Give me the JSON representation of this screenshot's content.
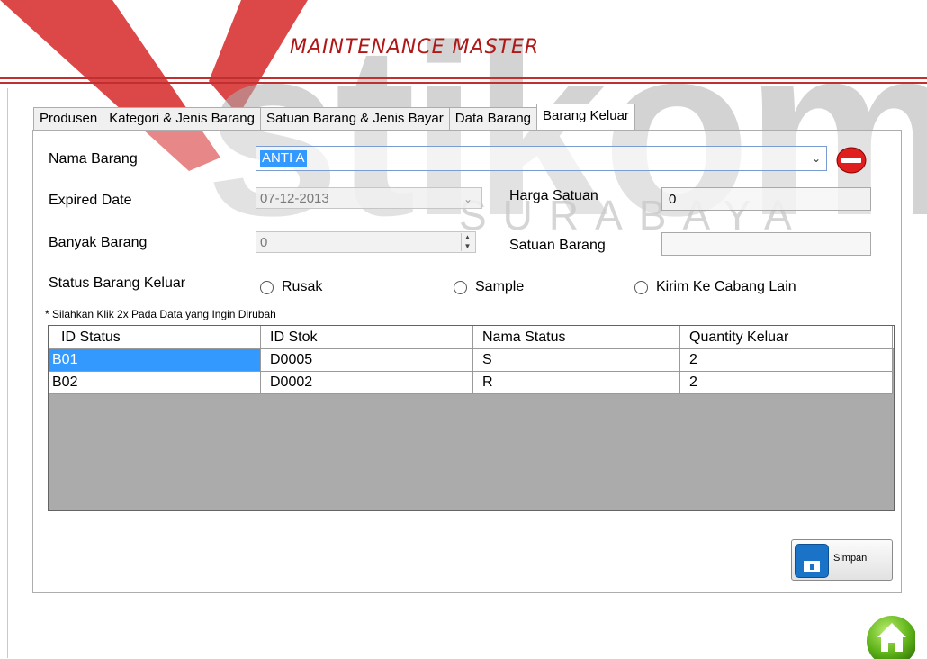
{
  "watermark": {
    "logo_text": "stikom",
    "subtitle": "SURABAYA"
  },
  "header": {
    "title": "MAINTENANCE MASTER"
  },
  "tabs": [
    {
      "label": "Produsen"
    },
    {
      "label": "Kategori & Jenis Barang"
    },
    {
      "label": "Satuan Barang & Jenis Bayar"
    },
    {
      "label": "Data Barang"
    },
    {
      "label": "Barang Keluar",
      "active": true
    }
  ],
  "form": {
    "nama_barang": {
      "label": "Nama Barang",
      "value": "ANTI A"
    },
    "expired_date": {
      "label": "Expired Date",
      "value": "07-12-2013"
    },
    "harga_satuan": {
      "label": "Harga Satuan",
      "value": "0"
    },
    "banyak_barang": {
      "label": "Banyak Barang",
      "value": "0"
    },
    "satuan_barang": {
      "label": "Satuan Barang",
      "value": ""
    },
    "status": {
      "label": "Status Barang Keluar",
      "options": [
        "Rusak",
        "Sample",
        "Kirim Ke Cabang Lain"
      ],
      "selected": null
    },
    "hint": "* Silahkan Klik 2x Pada Data yang Ingin Dirubah"
  },
  "grid": {
    "columns": [
      "ID Status",
      "ID Stok",
      "Nama Status",
      "Quantity Keluar"
    ],
    "rows": [
      [
        "B01",
        "D0005",
        "S",
        "2"
      ],
      [
        "B02",
        "D0002",
        "R",
        "2"
      ]
    ]
  },
  "buttons": {
    "save_label": "Simpan"
  },
  "icons": {
    "remove": "remove-icon",
    "save": "save-icon",
    "home": "home-icon"
  },
  "colors": {
    "title": "#b01818",
    "rule": "#c03030",
    "selection": "#3399ff",
    "grid_background": "#ababab"
  }
}
